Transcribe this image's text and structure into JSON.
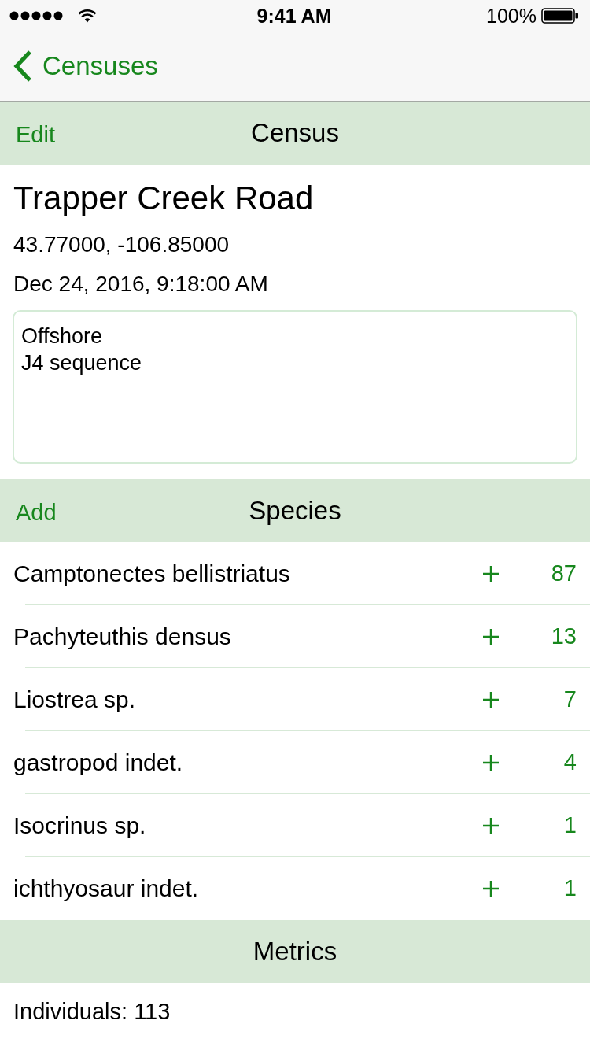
{
  "status_bar": {
    "time": "9:41 AM",
    "battery": "100%"
  },
  "nav_bar": {
    "back_label": "Censuses"
  },
  "census_section": {
    "title": "Census",
    "action": "Edit"
  },
  "census": {
    "name": "Trapper Creek Road",
    "coordinates": "43.77000, -106.85000",
    "date": "Dec 24, 2016, 9:18:00 AM",
    "notes": {
      "value": "Offshore\nJ4 sequence"
    }
  },
  "species_section": {
    "title": "Species",
    "action": "Add"
  },
  "species": [
    {
      "name": "Camptonectes bellistriatus",
      "count": "87"
    },
    {
      "name": "Pachyteuthis densus",
      "count": "13"
    },
    {
      "name": "Liostrea sp.",
      "count": "7"
    },
    {
      "name": "gastropod indet.",
      "count": "4"
    },
    {
      "name": "Isocrinus sp.",
      "count": "1"
    },
    {
      "name": "ichthyosaur indet.",
      "count": "1"
    }
  ],
  "metrics_section": {
    "title": "Metrics"
  },
  "metrics": [
    "Individuals: 113"
  ]
}
